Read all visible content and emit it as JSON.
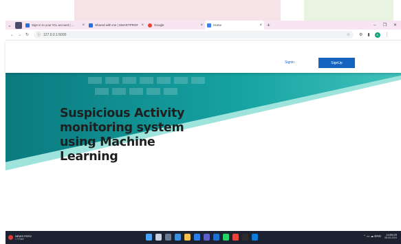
{
  "browser": {
    "tabs": [
      {
        "title": "Sign in to your IGL account | ...",
        "favicon_color": "#2d6fd6",
        "active": false
      },
      {
        "title": "Shared with me | SMARTPROF...",
        "favicon_color": "#2d6fd6",
        "active": false
      },
      {
        "title": "Google",
        "favicon_color": "#ea4335",
        "active": false
      },
      {
        "title": "Home",
        "favicon_color": "#3b82f6",
        "active": true
      }
    ],
    "new_tab_label": "+",
    "tab_close_label": "×",
    "url": "127.0.0.1:5000",
    "window_controls": {
      "minimize": "–",
      "maximize": "❐",
      "close": "✕"
    },
    "profile_initial": "A"
  },
  "page": {
    "nav": {
      "signin_label": "Signin",
      "signup_label": "SignUp"
    },
    "hero_title": "Suspicious Activity monitoring system using Machine Learning",
    "colors": {
      "teal_dark": "#0e7f83",
      "teal_mid": "#15a7a4",
      "teal_light": "#9fe4dc",
      "accent_blue": "#1565c0"
    }
  },
  "taskbar": {
    "weather_title": "NEWS FEED",
    "weather_sub": "1 TITAN",
    "clock_time": "14:59:29",
    "clock_date": "08-05-2024",
    "tray_text": "ENG"
  }
}
